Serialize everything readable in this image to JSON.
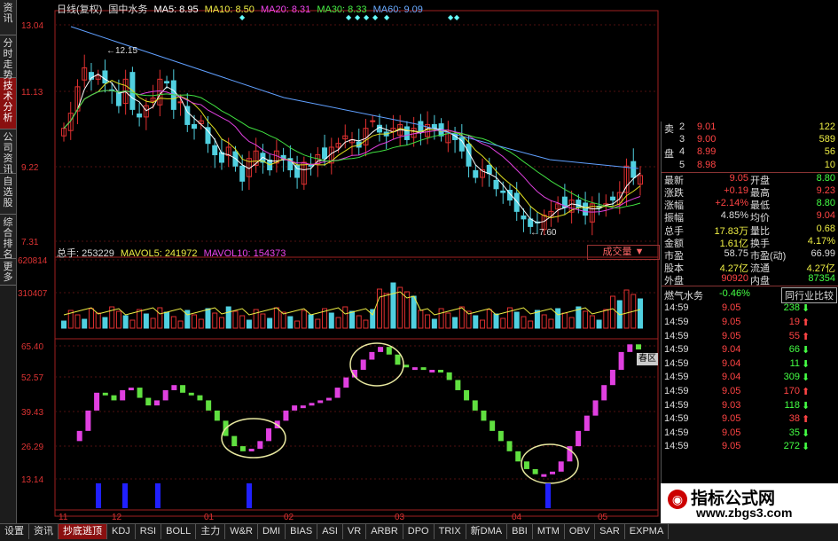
{
  "left_sidebar": [
    {
      "label": "资讯",
      "active": false
    },
    {
      "label": "分时走势",
      "active": false
    },
    {
      "label": "技术分析",
      "active": true
    },
    {
      "label": "公司资讯",
      "active": false
    },
    {
      "label": "自选股",
      "active": false
    },
    {
      "label": "综合排名",
      "active": false
    },
    {
      "label": "更多",
      "active": false
    }
  ],
  "header": {
    "period": "日线(复权)",
    "stock": "国中水务",
    "ma5": "MA5: 8.95",
    "ma10": "MA10: 8.50",
    "ma20": "MA20: 8.31",
    "ma30": "MA30: 8.33",
    "ma60": "MA60: 9.09"
  },
  "price_axis": [
    "13.04",
    "11.13",
    "9.22",
    "7.31"
  ],
  "price_annotations": {
    "high": "12.15",
    "low": "7.60"
  },
  "volume_header": {
    "total": "总手: 253229",
    "mavol5": "MAVOL5: 241972",
    "mavol10": "MAVOL10: 154373"
  },
  "volume_button": "成交量",
  "volume_axis": [
    "620814",
    "310407"
  ],
  "indicator_axis": [
    "65.40",
    "52.57",
    "39.43",
    "26.29",
    "13.14"
  ],
  "spring_button": "春区",
  "x_axis": [
    "11",
    "12",
    "01",
    "02",
    "03",
    "04",
    "05"
  ],
  "colors": {
    "up": "#e03030",
    "down": "#50d0e0",
    "ma5": "#ffffff",
    "ma10": "#e0e020",
    "ma20": "#e040e0",
    "ma30": "#40e040",
    "ma60": "#60a0ff",
    "ind_up": "#e040e0",
    "ind_down": "#60e040",
    "signal": "#2020ff",
    "circle": "#e8e8a0"
  },
  "quote_top": [
    {
      "side": "卖",
      "level": "2",
      "price": "9.01",
      "vol": "122"
    },
    {
      "side": "",
      "level": "3",
      "price": "9.00",
      "vol": "589"
    },
    {
      "side": "盘",
      "level": "4",
      "price": "8.99",
      "vol": "56"
    },
    {
      "side": "",
      "level": "5",
      "price": "8.98",
      "vol": "10"
    }
  ],
  "quote_stats": [
    {
      "l1": "最新",
      "v1": "9.05",
      "l2": "开盘",
      "v2": "8.80",
      "c1": "#f44",
      "c2": "#4f4"
    },
    {
      "l1": "涨跌",
      "v1": "+0.19",
      "l2": "最高",
      "v2": "9.23",
      "c1": "#f44",
      "c2": "#f44"
    },
    {
      "l1": "涨幅",
      "v1": "+2.14%",
      "l2": "最低",
      "v2": "8.80",
      "c1": "#f44",
      "c2": "#4f4"
    },
    {
      "l1": "振幅",
      "v1": "4.85%",
      "l2": "均价",
      "v2": "9.04",
      "c1": "#ddd",
      "c2": "#f44"
    },
    {
      "l1": "总手",
      "v1": "17.83万",
      "l2": "量比",
      "v2": "0.68",
      "c1": "#ee4",
      "c2": "#ee4"
    },
    {
      "l1": "金额",
      "v1": "1.61亿",
      "l2": "换手",
      "v2": "4.17%",
      "c1": "#ee4",
      "c2": "#ee4"
    },
    {
      "l1": "市盈",
      "v1": "58.75",
      "l2": "市盈(动)",
      "v2": "66.99",
      "c1": "#ddd",
      "c2": "#ddd"
    },
    {
      "l1": "股本",
      "v1": "4.27亿",
      "l2": "流通",
      "v2": "4.27亿",
      "c1": "#ee4",
      "c2": "#ee4"
    },
    {
      "l1": "外盘",
      "v1": "90920",
      "l2": "内盘",
      "v2": "87354",
      "c1": "#f44",
      "c2": "#4f4"
    }
  ],
  "sector": {
    "name": "燃气水务",
    "change": "-0.46%",
    "button": "同行业比较"
  },
  "ticks": [
    {
      "time": "14:59",
      "price": "9.05",
      "vol": "238",
      "dir": "down"
    },
    {
      "time": "14:59",
      "price": "9.05",
      "vol": "19",
      "dir": "up"
    },
    {
      "time": "14:59",
      "price": "9.05",
      "vol": "55",
      "dir": "up"
    },
    {
      "time": "14:59",
      "price": "9.04",
      "vol": "66",
      "dir": "down"
    },
    {
      "time": "14:59",
      "price": "9.04",
      "vol": "11",
      "dir": "down"
    },
    {
      "time": "14:59",
      "price": "9.04",
      "vol": "309",
      "dir": "down"
    },
    {
      "time": "14:59",
      "price": "9.05",
      "vol": "170",
      "dir": "up"
    },
    {
      "time": "14:59",
      "price": "9.03",
      "vol": "118",
      "dir": "down"
    },
    {
      "time": "14:59",
      "price": "9.05",
      "vol": "38",
      "dir": "up"
    },
    {
      "time": "14:59",
      "price": "9.05",
      "vol": "35",
      "dir": "down"
    },
    {
      "time": "14:59",
      "price": "9.05",
      "vol": "272",
      "dir": "down"
    }
  ],
  "bottom_tabs": [
    {
      "label": "设置",
      "active": false
    },
    {
      "label": "资讯",
      "active": false
    },
    {
      "label": "抄底逃顶",
      "active": true
    },
    {
      "label": "KDJ",
      "active": false
    },
    {
      "label": "RSI",
      "active": false
    },
    {
      "label": "BOLL",
      "active": false
    },
    {
      "label": "主力",
      "active": false
    },
    {
      "label": "W&R",
      "active": false
    },
    {
      "label": "DMI",
      "active": false
    },
    {
      "label": "BIAS",
      "active": false
    },
    {
      "label": "ASI",
      "active": false
    },
    {
      "label": "VR",
      "active": false
    },
    {
      "label": "ARBR",
      "active": false
    },
    {
      "label": "DPO",
      "active": false
    },
    {
      "label": "TRIX",
      "active": false
    },
    {
      "label": "新DMA",
      "active": false
    },
    {
      "label": "BBI",
      "active": false
    },
    {
      "label": "MTM",
      "active": false
    },
    {
      "label": "OBV",
      "active": false
    },
    {
      "label": "SAR",
      "active": false
    },
    {
      "label": "EXPMA",
      "active": false
    }
  ],
  "watermark": {
    "title": "指标公式网",
    "url": "www.zbgs3.com"
  },
  "chart_data": {
    "type": "candlestick",
    "price_range": [
      7.31,
      13.04
    ],
    "price_candles": [
      10.3,
      10.7,
      11.4,
      11.9,
      11.6,
      11.7,
      11.5,
      11.3,
      10.9,
      11.6,
      10.8,
      10.6,
      10.9,
      11.1,
      11.6,
      11.5,
      10.8,
      11.0,
      10.4,
      10.3,
      10.5,
      9.9,
      9.6,
      9.4,
      9.8,
      9.3,
      8.9,
      9.5,
      9.7,
      9.4,
      9.2,
      9.7,
      9.5,
      9.2,
      9.0,
      9.4,
      9.3,
      9.6,
      9.5,
      9.8,
      9.9,
      10.1,
      10.0,
      9.8,
      10.3,
      10.5,
      10.2,
      10.1,
      10.3,
      10.4,
      10.0,
      10.3,
      10.2,
      10.4,
      10.3,
      10.1,
      10.2,
      10.0,
      9.7,
      9.3,
      9.0,
      9.2,
      9.1,
      8.7,
      8.6,
      8.4,
      8.1,
      7.9,
      7.7,
      7.8,
      8.0,
      8.1,
      8.3,
      8.2,
      8.4,
      8.2,
      8.0,
      8.3,
      8.2,
      8.3,
      8.4,
      8.6,
      9.3,
      9.0,
      9.05
    ],
    "indicator_range": [
      13.14,
      65.4
    ],
    "indicator": [
      28,
      32,
      40,
      47,
      46,
      44,
      48,
      49,
      45,
      42,
      44,
      48,
      50,
      47,
      46,
      44,
      40,
      36,
      30,
      26,
      24,
      25,
      28,
      33,
      36,
      40,
      42,
      42,
      43,
      44,
      45,
      49,
      53,
      56,
      60,
      63,
      65,
      62,
      58,
      57,
      57,
      56,
      56,
      55,
      52,
      48,
      44,
      40,
      36,
      32,
      28,
      24,
      20,
      17,
      15,
      15,
      16,
      20,
      26,
      32,
      38,
      44,
      50,
      56,
      63,
      66,
      64
    ],
    "signal_bars": [
      5,
      11,
      18,
      35,
      78
    ]
  }
}
